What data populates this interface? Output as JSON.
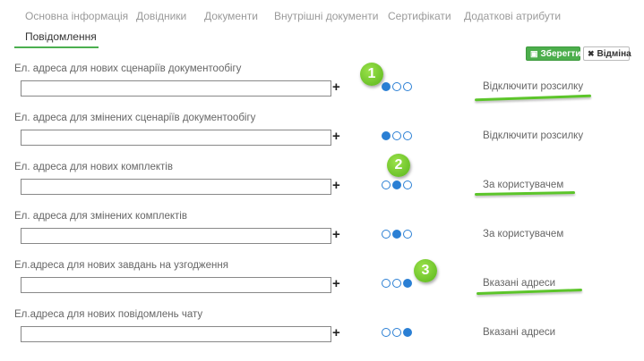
{
  "tabs": [
    {
      "label": "Основна інформація"
    },
    {
      "label": "Довідники"
    },
    {
      "label": "Документи"
    },
    {
      "label": "Внутрішні документи"
    },
    {
      "label": "Сертифікати"
    },
    {
      "label": "Додаткові атрибути"
    },
    {
      "label": "Повідомлення"
    }
  ],
  "active_tab": "Повідомлення",
  "toolbar": {
    "save_label": "Зберегти",
    "cancel_label": "Відміна"
  },
  "plus_symbol": "+",
  "fields": [
    {
      "label": "Ел. адреса для нових сценаріїв документообігу",
      "value": "",
      "selected": 0,
      "mode": "Відключити розсилку"
    },
    {
      "label": "Ел. адреса для змінених сценаріїв документообігу",
      "value": "",
      "selected": 0,
      "mode": "Відключити розсилку"
    },
    {
      "label": "Ел. адреса для нових комплектів",
      "value": "",
      "selected": 1,
      "mode": "За користувачем"
    },
    {
      "label": "Ел. адреса для змінених комплектів",
      "value": "",
      "selected": 1,
      "mode": "За користувачем"
    },
    {
      "label": "Ел.адреса для нових завдань на узгодження",
      "value": "",
      "selected": 2,
      "mode": "Вказані адреси"
    },
    {
      "label": "Ел.адреса для нових повідомлень чату",
      "value": "",
      "selected": 2,
      "mode": "Вказані адреси"
    }
  ],
  "badges": [
    "1",
    "2",
    "3"
  ],
  "colors": {
    "accent_green": "#4caf50",
    "radio_blue": "#2a7fd4",
    "highlight_green": "#5cc52a"
  }
}
